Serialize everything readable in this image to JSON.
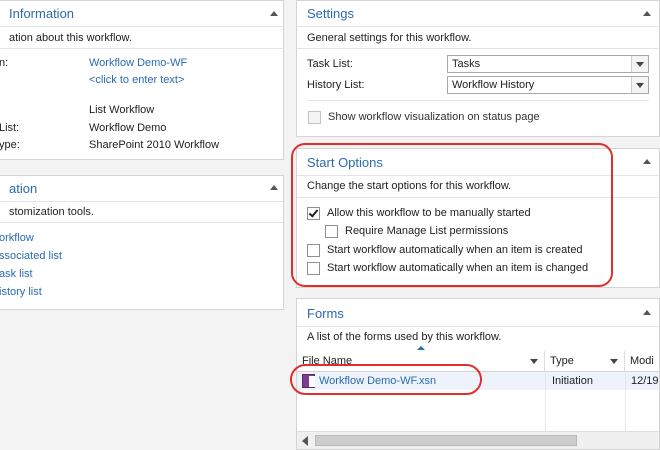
{
  "information": {
    "title": "Information",
    "description": "ation about this workflow.",
    "rows": [
      {
        "label": "n:",
        "value": "Workflow Demo-WF"
      },
      {
        "label": "",
        "value": "<click to enter text>"
      },
      {
        "label": "",
        "value": "List Workflow"
      },
      {
        "label": "List:",
        "value": "Workflow Demo"
      },
      {
        "label": "ype:",
        "value": "SharePoint 2010 Workflow"
      }
    ]
  },
  "customization": {
    "title": "ation",
    "description": "stomization tools.",
    "links": [
      "orkflow",
      "ssociated list",
      "ask list",
      "istory list"
    ]
  },
  "settings": {
    "title": "Settings",
    "description": "General settings for this workflow.",
    "task_list_label": "Task List:",
    "task_list_value": "Tasks",
    "history_list_label": "History List:",
    "history_list_value": "Workflow History",
    "show_visualization_label": "Show workflow visualization on status page"
  },
  "start_options": {
    "title": "Start Options",
    "description": "Change the start options for this workflow.",
    "options": [
      {
        "label": "Allow this workflow to be manually started",
        "checked": true
      },
      {
        "label": "Require Manage List permissions",
        "checked": false
      },
      {
        "label": "Start workflow automatically when an item is created",
        "checked": false
      },
      {
        "label": "Start workflow automatically when an item is changed",
        "checked": false
      }
    ]
  },
  "forms": {
    "title": "Forms",
    "description": "A list of the forms used by this workflow.",
    "columns": [
      "File Name",
      "Type",
      "Modi"
    ],
    "rows": [
      {
        "file_name": "Workflow Demo-WF.xsn",
        "type": "Initiation",
        "modified": "12/19"
      }
    ]
  },
  "colors": {
    "accent": "#2a6bb0",
    "annotation": "#e02e2e"
  }
}
